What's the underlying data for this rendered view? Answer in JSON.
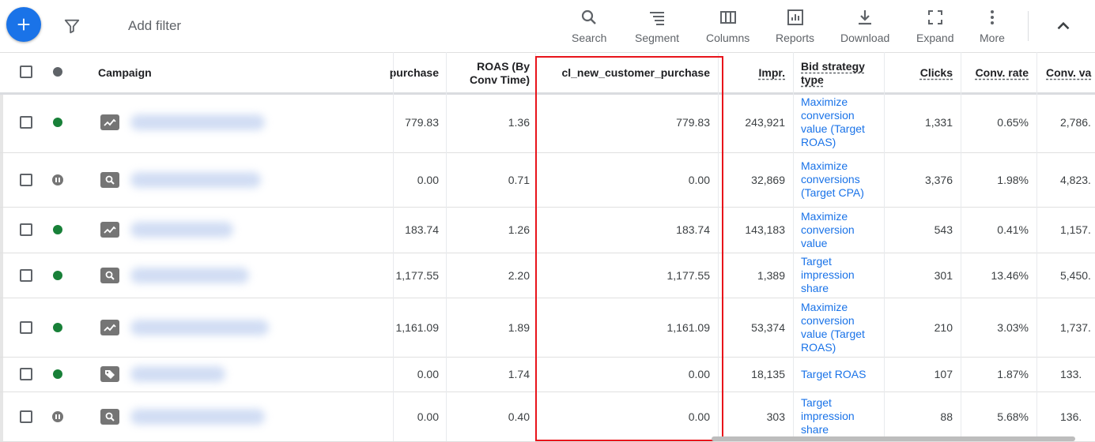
{
  "toolbar": {
    "add_filter": "Add filter",
    "tools": [
      {
        "label": "Search",
        "icon": "search-icon"
      },
      {
        "label": "Segment",
        "icon": "segment-icon"
      },
      {
        "label": "Columns",
        "icon": "columns-icon"
      },
      {
        "label": "Reports",
        "icon": "reports-icon"
      },
      {
        "label": "Download",
        "icon": "download-icon"
      },
      {
        "label": "Expand",
        "icon": "expand-icon"
      },
      {
        "label": "More",
        "icon": "more-icon"
      }
    ]
  },
  "table": {
    "headers": {
      "campaign": "Campaign",
      "purchase": "purchase",
      "roas_line1": "ROAS (By",
      "roas_line2": "Conv Time)",
      "new_customer": "cl_new_customer_purchase",
      "impr": "Impr.",
      "bid_line1": "Bid strategy",
      "bid_line2": "type",
      "clicks": "Clicks",
      "conv_rate": "Conv. rate",
      "conv_value": "Conv. va"
    },
    "rows": [
      {
        "status": "enabled",
        "type": "performance-max-icon",
        "purchase": "779.83",
        "roas": "1.36",
        "new_customer": "779.83",
        "impr": "243,921",
        "bid": [
          "Maximize",
          "conversion",
          "value (Target",
          "ROAS)"
        ],
        "clicks": "1,331",
        "conv_rate": "0.65%",
        "conv_value": "2,786."
      },
      {
        "status": "paused",
        "type": "search-campaign-icon",
        "purchase": "0.00",
        "roas": "0.71",
        "new_customer": "0.00",
        "impr": "32,869",
        "bid": [
          "Maximize",
          "conversions",
          "(Target CPA)"
        ],
        "clicks": "3,376",
        "conv_rate": "1.98%",
        "conv_value": "4,823."
      },
      {
        "status": "enabled",
        "type": "performance-max-icon",
        "purchase": "183.74",
        "roas": "1.26",
        "new_customer": "183.74",
        "impr": "143,183",
        "bid": [
          "Maximize",
          "conversion",
          "value"
        ],
        "clicks": "543",
        "conv_rate": "0.41%",
        "conv_value": "1,157."
      },
      {
        "status": "enabled",
        "type": "search-campaign-icon",
        "purchase": "1,177.55",
        "roas": "2.20",
        "new_customer": "1,177.55",
        "impr": "1,389",
        "bid": [
          "Target",
          "impression",
          "share"
        ],
        "clicks": "301",
        "conv_rate": "13.46%",
        "conv_value": "5,450."
      },
      {
        "status": "enabled",
        "type": "performance-max-icon",
        "purchase": "1,161.09",
        "roas": "1.89",
        "new_customer": "1,161.09",
        "impr": "53,374",
        "bid": [
          "Maximize",
          "conversion",
          "value (Target",
          "ROAS)"
        ],
        "clicks": "210",
        "conv_rate": "3.03%",
        "conv_value": "1,737."
      },
      {
        "status": "enabled",
        "type": "shopping-campaign-icon",
        "purchase": "0.00",
        "roas": "1.74",
        "new_customer": "0.00",
        "impr": "18,135",
        "bid": [
          "Target ROAS"
        ],
        "clicks": "107",
        "conv_rate": "1.87%",
        "conv_value": "133."
      },
      {
        "status": "paused",
        "type": "search-campaign-icon",
        "purchase": "0.00",
        "roas": "0.40",
        "new_customer": "0.00",
        "impr": "303",
        "bid": [
          "Target",
          "impression",
          "share"
        ],
        "clicks": "88",
        "conv_rate": "5.68%",
        "conv_value": "136."
      }
    ]
  },
  "colors": {
    "accent": "#1a73e8",
    "enabled": "#188038",
    "paused": "#757575",
    "highlight": "#e8141b"
  }
}
